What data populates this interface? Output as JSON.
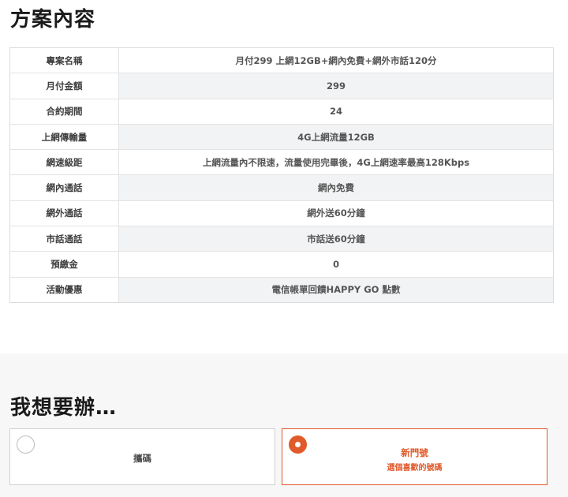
{
  "plan_section": {
    "title": "方案內容",
    "rows": [
      {
        "label": "專案名稱",
        "value": "月付299 上網12GB+網內免費+網外市話120分"
      },
      {
        "label": "月付金額",
        "value": "299"
      },
      {
        "label": "合約期間",
        "value": "24"
      },
      {
        "label": "上網傳輸量",
        "value": "4G上網流量12GB"
      },
      {
        "label": "網速級距",
        "value": "上網流量內不限速，流量使用完畢後，4G上網速率最高128Kbps"
      },
      {
        "label": "網內通話",
        "value": "網內免費"
      },
      {
        "label": "網外通話",
        "value": "網外送60分鐘"
      },
      {
        "label": "市話通話",
        "value": "市話送60分鐘"
      },
      {
        "label": "預繳金",
        "value": "0"
      },
      {
        "label": "活動優惠",
        "value": "電信帳單回饋HAPPY GO 點數"
      }
    ]
  },
  "choose_section": {
    "title": "我想要辦…",
    "options": [
      {
        "label": "攜碼",
        "sub": "",
        "selected": false
      },
      {
        "label": "新門號",
        "sub": "選個喜歡的號碼",
        "selected": true
      }
    ]
  },
  "colors": {
    "accent": "#e05a2b",
    "row_alt_bg": "#f1f3f5",
    "section_bg": "#f7f7f7"
  }
}
